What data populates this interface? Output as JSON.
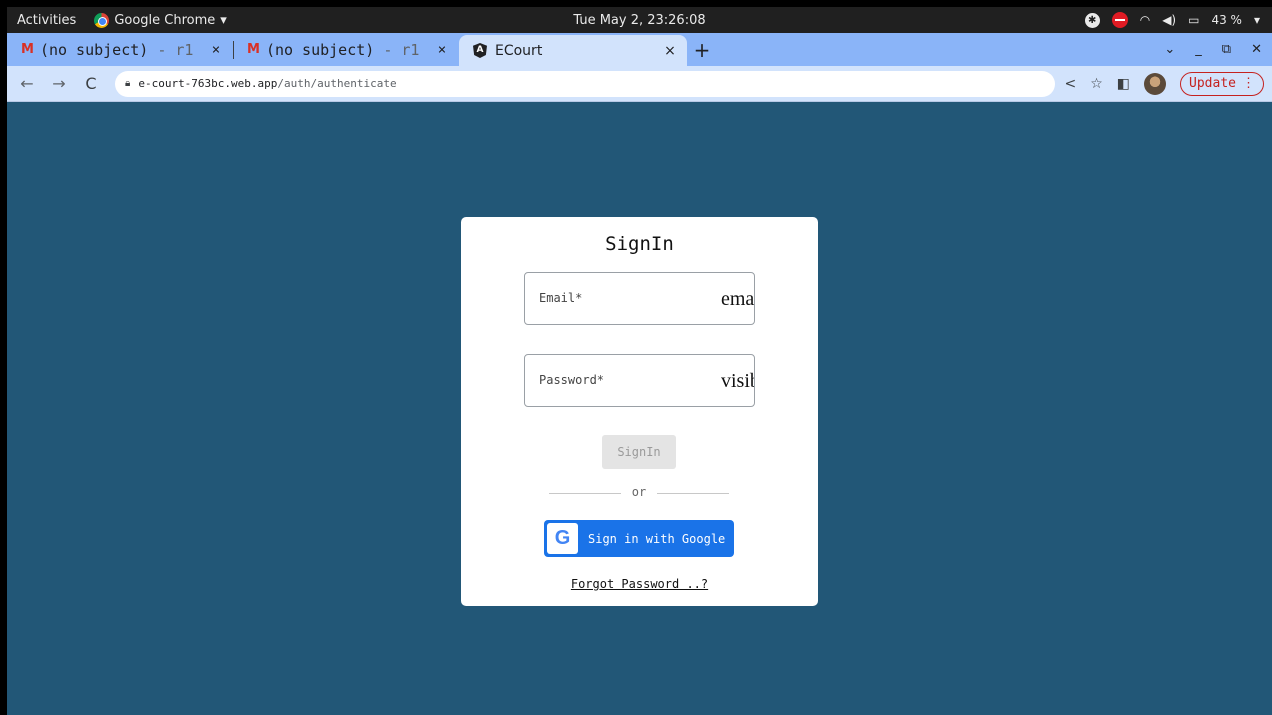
{
  "system_bar": {
    "activities": "Activities",
    "app_name": "Google Chrome",
    "app_menu_arrow": "▾",
    "clock": "Tue May 2, 23:26:08",
    "battery": "43 %",
    "tray_arrow": "▾"
  },
  "tabs": [
    {
      "title_main": "(no subject)",
      "title_dim": " - r1",
      "icon": "gmail-icon"
    },
    {
      "title_main": "(no subject)",
      "title_dim": " - r1",
      "icon": "gmail-icon"
    },
    {
      "title_main": "ECourt",
      "title_dim": "",
      "icon": "angular-icon",
      "active": true
    }
  ],
  "tab_close": "×",
  "new_tab": "+",
  "address_bar": {
    "url_host": "e-court-763bc.web.app",
    "url_path": "/auth/authenticate",
    "update_label": "Update"
  },
  "signin_card": {
    "title": "SignIn",
    "email_label": "Email*",
    "email_value": "email",
    "password_label": "Password*",
    "password_value": "visible",
    "signin_button": "SignIn",
    "divider_text": "or",
    "google_button": "Sign in with Google",
    "google_mark": "G",
    "forgot_link": "Forgot Password ..?"
  },
  "colors": {
    "page_background": "#225777",
    "tab_strip": "#8ab4f8",
    "google_button": "#1a73e8"
  }
}
